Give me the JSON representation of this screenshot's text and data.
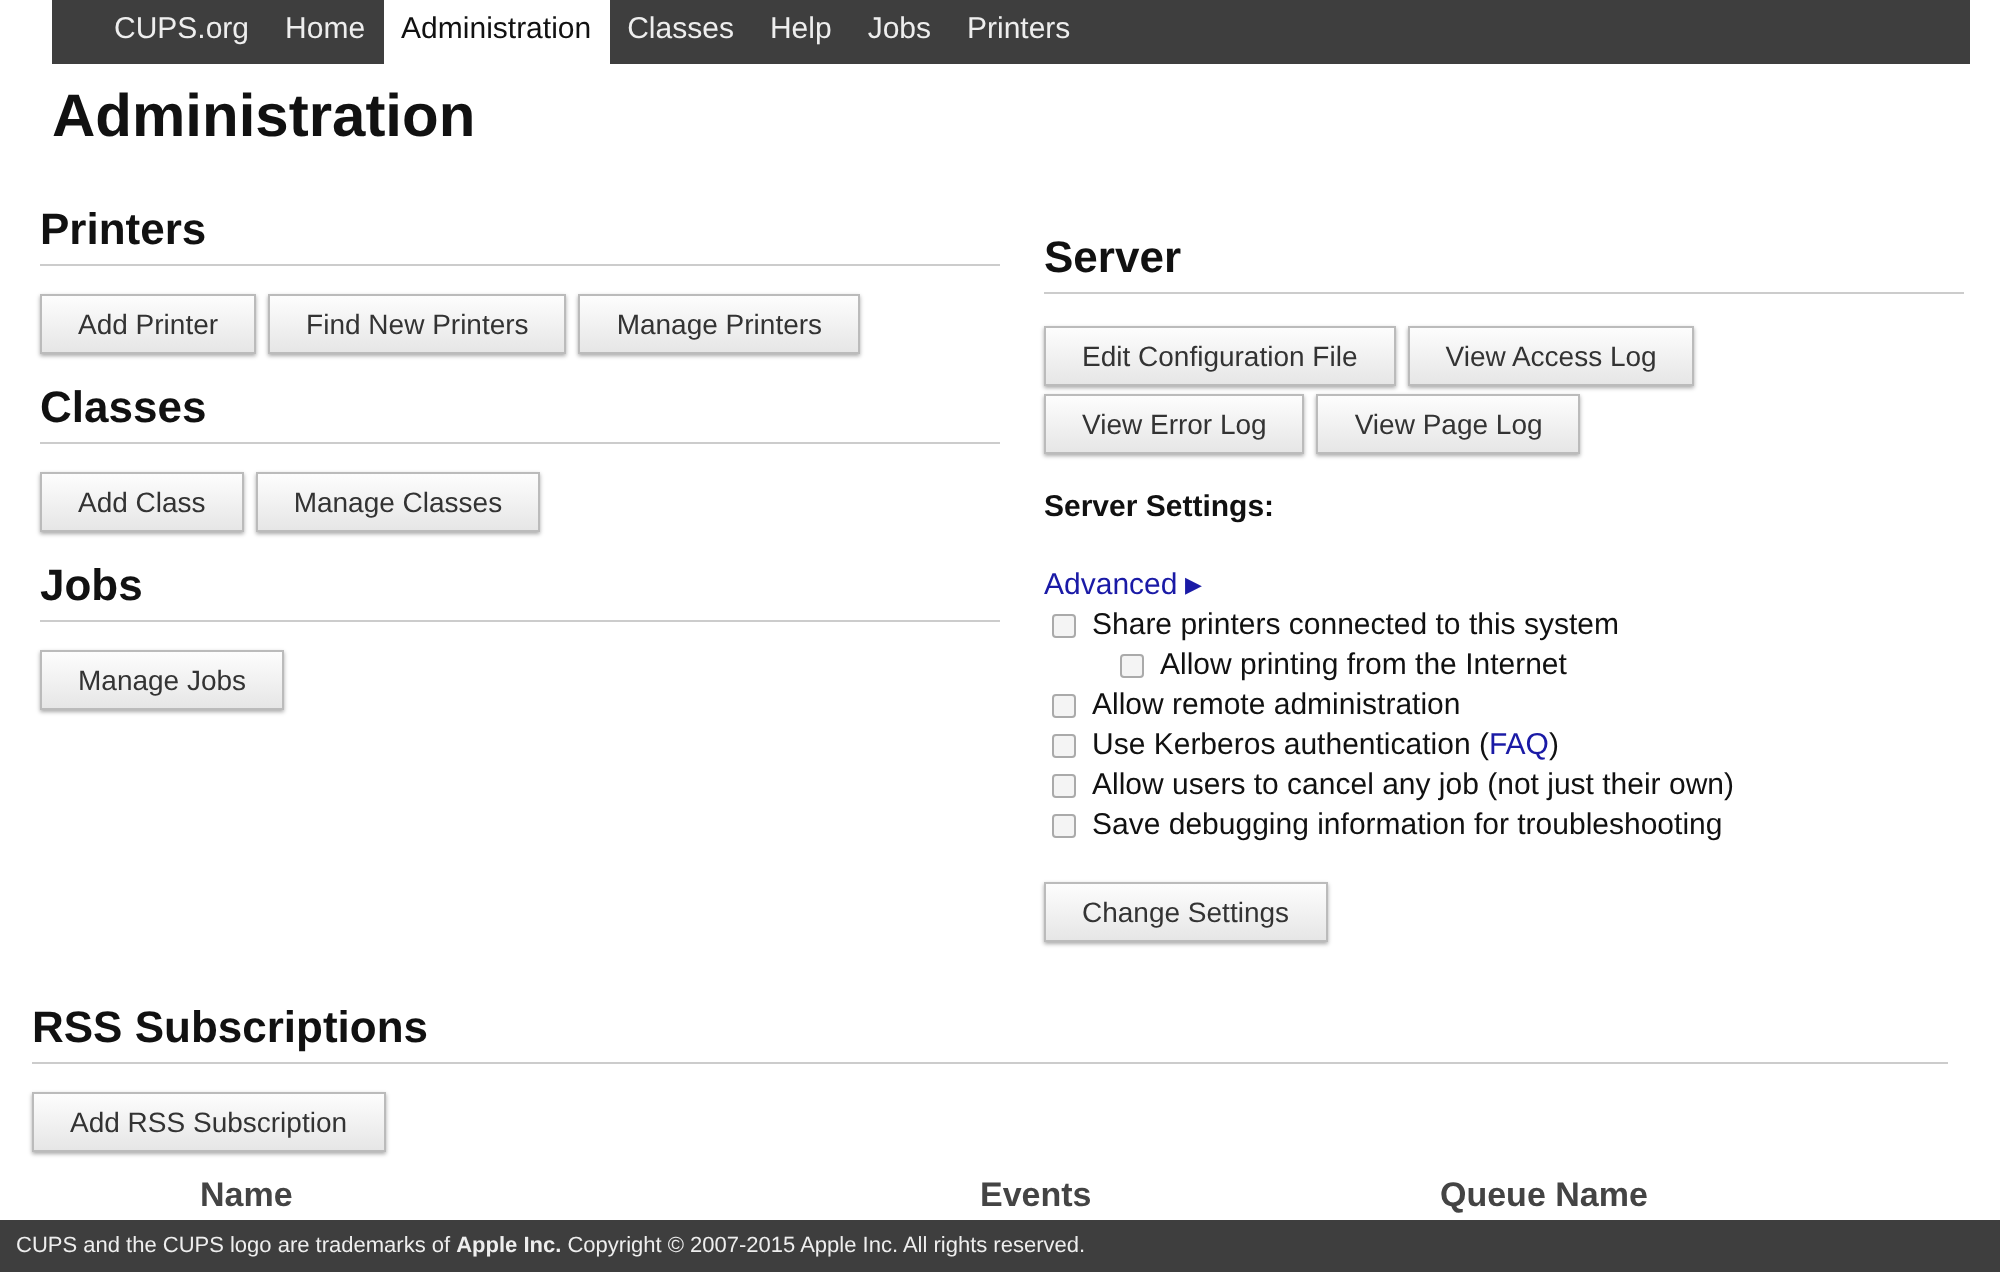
{
  "nav": [
    {
      "label": "CUPS.org",
      "selected": false
    },
    {
      "label": "Home",
      "selected": false
    },
    {
      "label": "Administration",
      "selected": true
    },
    {
      "label": "Classes",
      "selected": false
    },
    {
      "label": "Help",
      "selected": false
    },
    {
      "label": "Jobs",
      "selected": false
    },
    {
      "label": "Printers",
      "selected": false
    }
  ],
  "title": "Administration",
  "left_sections": [
    {
      "heading": "Printers",
      "buttons": [
        "Add Printer",
        "Find New Printers",
        "Manage Printers"
      ]
    },
    {
      "heading": "Classes",
      "buttons": [
        "Add Class",
        "Manage Classes"
      ]
    },
    {
      "heading": "Jobs",
      "buttons": [
        "Manage Jobs"
      ]
    }
  ],
  "server": {
    "heading": "Server",
    "buttons": [
      "Edit Configuration File",
      "View Access Log",
      "View Error Log",
      "View Page Log"
    ],
    "settings_label": "Server Settings:",
    "advanced": {
      "label": "Advanced",
      "arrow": "▶"
    },
    "options": [
      {
        "label": "Share printers connected to this system",
        "checked": false,
        "children": [
          {
            "label": "Allow printing from the Internet",
            "checked": false
          }
        ]
      },
      {
        "label": "Allow remote administration",
        "checked": false
      },
      {
        "label": "Use Kerberos authentication (",
        "link": "FAQ",
        "after": ")",
        "checked": false
      },
      {
        "label": "Allow users to cancel any job (not just their own)",
        "checked": false
      },
      {
        "label": "Save debugging information for troubleshooting",
        "checked": false
      }
    ],
    "submit": "Change Settings"
  },
  "rss": {
    "heading": "RSS Subscriptions",
    "buttons": [
      "Add RSS Subscription"
    ]
  },
  "table": {
    "columns": [
      "Name",
      "Events",
      "Queue Name"
    ]
  },
  "footer": "CUPS and the CUPS logo are trademarks of **Apple Inc.** Copyright © 2007-2015 Apple Inc. All rights reserved."
}
